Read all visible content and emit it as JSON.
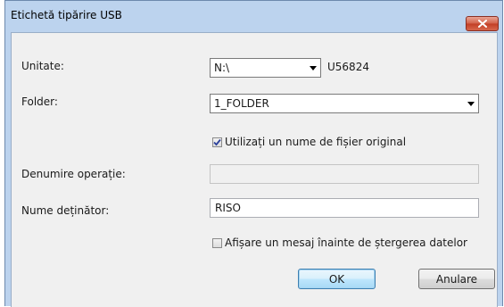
{
  "window": {
    "title": "Etichetă tipărire USB"
  },
  "form": {
    "unit": {
      "label": "Unitate:",
      "value": "N:\\",
      "device_id": "U56824"
    },
    "folder": {
      "label": "Folder:",
      "value": "1_FOLDER"
    },
    "use_original_name": {
      "label": "Utilizați un nume de fișier original",
      "checked": true
    },
    "job_name": {
      "label": "Denumire operație:",
      "value": ""
    },
    "owner_name": {
      "label": "Nume deținător:",
      "value": "RISO"
    },
    "show_delete_message": {
      "label": "Afișare un mesaj înainte de ștergerea datelor",
      "checked": false
    }
  },
  "buttons": {
    "ok": "OK",
    "cancel": "Anulare"
  },
  "colors": {
    "close_button": "#c94a34",
    "default_button_border": "#3c7fb1",
    "dialog_frame": "#bcd3ee"
  },
  "icons": [
    "close-icon",
    "dropdown-arrow-icon",
    "checkmark-icon"
  ]
}
